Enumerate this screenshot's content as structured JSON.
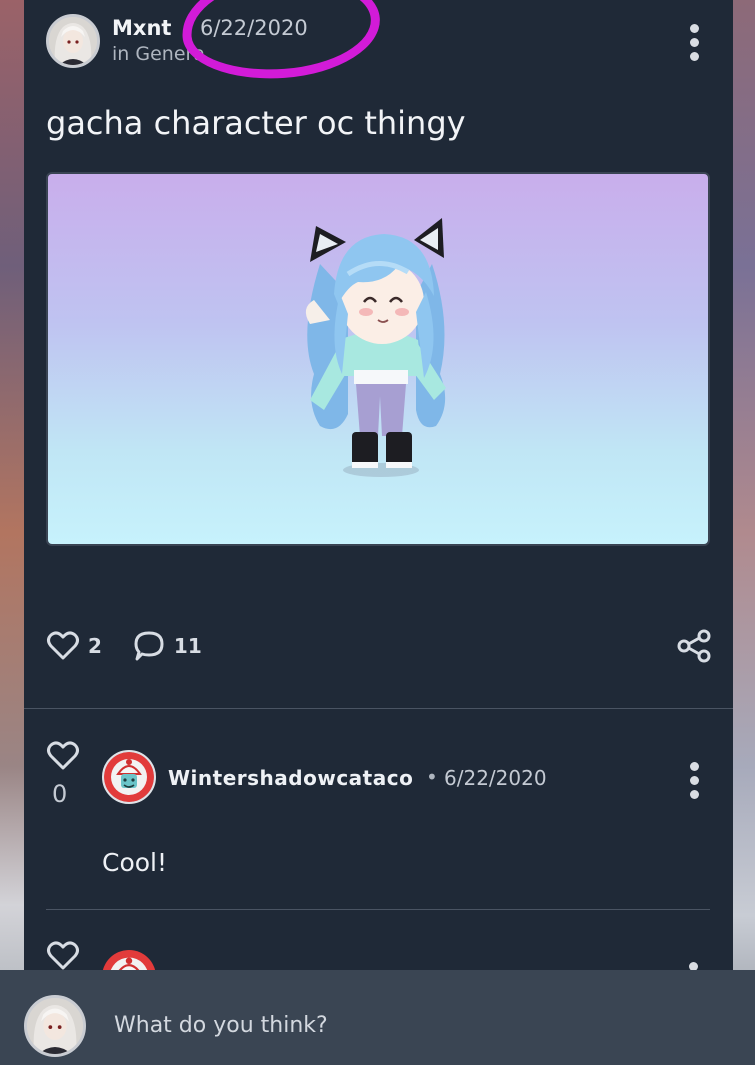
{
  "post": {
    "author": "Mxnt",
    "date": "6/22/2020",
    "category": "in Genera",
    "title": "gacha character oc thingy",
    "likes": "2",
    "comments": "11"
  },
  "comments": [
    {
      "author": "Wintershadowcataco",
      "separator": "•",
      "date": "6/22/2020",
      "votes": "0",
      "text": "Cool!"
    }
  ],
  "reply": {
    "placeholder": "What do you think?"
  },
  "colors": {
    "card_bg": "#1f2937",
    "reply_bar_bg": "#3a4553",
    "annotation_highlight": "#d21bd8"
  },
  "icons": {
    "like": "heart-outline-icon",
    "comment": "speech-bubble-icon",
    "share": "share-icon",
    "more": "kebab-menu-icon"
  }
}
